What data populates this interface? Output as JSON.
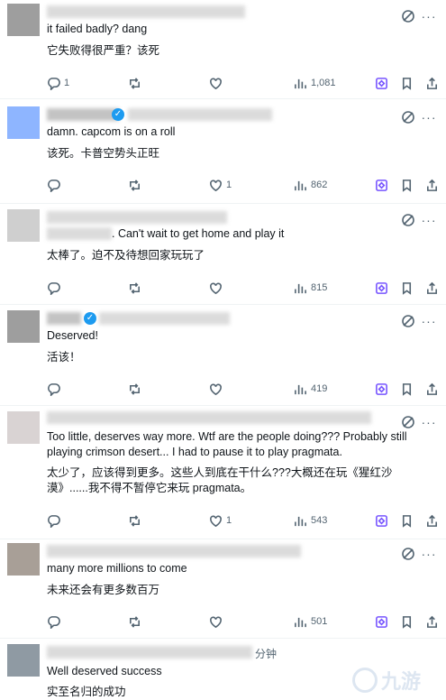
{
  "replies": [
    {
      "name_hint": "",
      "text_en": "it failed badly? dang",
      "text_zh": "它失败得很严重？该死",
      "reply_count": "1",
      "retweet_count": "",
      "like_count": "",
      "views": "1,081"
    },
    {
      "name_hint": "",
      "text_en": "damn. capcom is on a roll",
      "text_zh": "该死。卡普空势头正旺",
      "reply_count": "",
      "retweet_count": "",
      "like_count": "1",
      "views": "862"
    },
    {
      "name_hint": "",
      "text_en": ". Can't wait to get home and play it",
      "text_zh": "太棒了。迫不及待想回家玩玩了",
      "reply_count": "",
      "retweet_count": "",
      "like_count": "",
      "views": "815"
    },
    {
      "name_hint": "",
      "text_en": "Deserved!",
      "text_zh": "活该！",
      "reply_count": "",
      "retweet_count": "",
      "like_count": "",
      "views": "419"
    },
    {
      "name_hint": "",
      "text_en": "Too little, deserves way more. Wtf are the people doing??? Probably still playing crimson desert... I had to pause it to play pragmata.",
      "text_zh": "太少了，应该得到更多。这些人到底在干什么???大概还在玩《猩红沙漠》......我不得不暂停它来玩 pragmata。",
      "reply_count": "",
      "retweet_count": "",
      "like_count": "1",
      "views": "543"
    },
    {
      "name_hint": "",
      "text_en": "many more millions to come",
      "text_zh": "未来还会有更多数百万",
      "reply_count": "",
      "retweet_count": "",
      "like_count": "",
      "views": "501"
    },
    {
      "name_hint": "分钟",
      "text_en": "Well deserved success",
      "text_zh": "实至名归的成功",
      "reply_count": "",
      "retweet_count": "",
      "like_count": "",
      "views": ""
    }
  ],
  "icons": {
    "reply": "reply-icon",
    "retweet": "retweet-icon",
    "like": "heart-icon",
    "views": "views-icon",
    "grok": "grok-icon",
    "bookmark": "bookmark-icon",
    "share": "share-icon",
    "more": "more-icon"
  },
  "watermark": "九游",
  "colors": {
    "text": "#0f1419",
    "muted": "#536471",
    "verified": "#1d9bf0",
    "grok": "#7856ff"
  }
}
